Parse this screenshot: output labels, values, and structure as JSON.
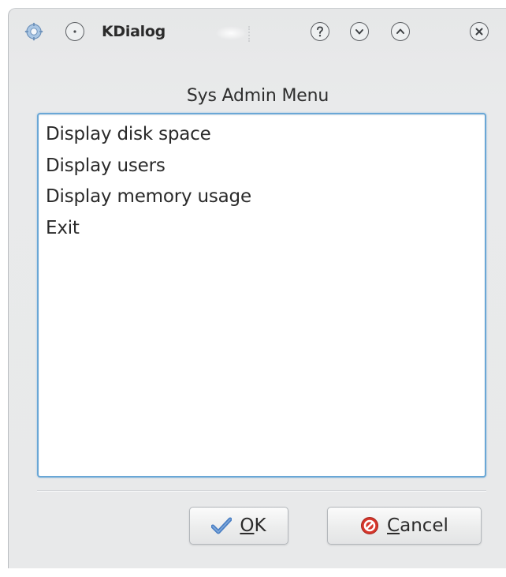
{
  "window": {
    "title": "KDialog"
  },
  "titlebar": {
    "icons": [
      "app-menu-icon",
      "sticky-icon",
      "help-icon",
      "minimize-icon",
      "maximize-icon",
      "close-icon"
    ]
  },
  "dialog": {
    "heading": "Sys Admin Menu",
    "items": [
      {
        "label": "Display disk space"
      },
      {
        "label": "Display users"
      },
      {
        "label": "Display memory usage"
      },
      {
        "label": "Exit"
      }
    ]
  },
  "buttons": {
    "ok": {
      "mnemonic": "O",
      "rest": "K",
      "icon": "checkmark-icon"
    },
    "cancel": {
      "mnemonic": "C",
      "rest": "ancel",
      "icon": "cancel-icon"
    }
  },
  "colors": {
    "list_border": "#6aa7d6",
    "ok_check": "#4a7fc4",
    "cancel_red": "#d6362b"
  }
}
